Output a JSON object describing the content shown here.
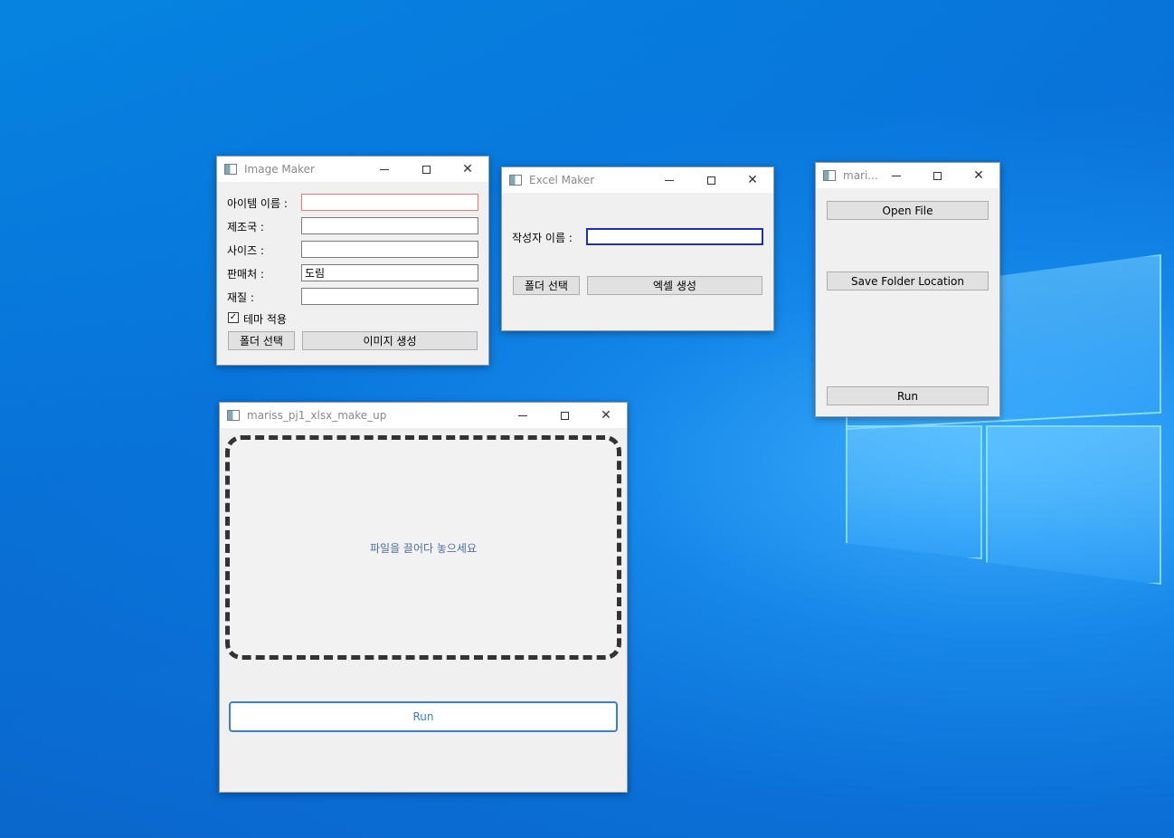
{
  "image_maker": {
    "title": "Image Maker",
    "fields": [
      {
        "label": "아이템 이름 :",
        "value": ""
      },
      {
        "label": "제조국 :",
        "value": ""
      },
      {
        "label": "사이즈 :",
        "value": ""
      },
      {
        "label": "판매처 :",
        "value": "도림"
      },
      {
        "label": "재질 :",
        "value": ""
      }
    ],
    "theme_checkbox_label": "테마 적용",
    "theme_checked": true,
    "folder_button": "폴더 선택",
    "generate_button": "이미지 생성"
  },
  "excel_maker": {
    "title": "Excel Maker",
    "author_label": "작성자 이름 :",
    "author_value": "",
    "folder_button": "폴더 선택",
    "generate_button": "엑셀 생성"
  },
  "small_window": {
    "title": "mari...",
    "open_button": "Open File",
    "save_button": "Save Folder Location",
    "run_button": "Run"
  },
  "main_window": {
    "title": "mariss_pj1_xlsx_make_up",
    "drop_text": "파일을 끌어다 놓으세요",
    "run_button": "Run",
    "accent": "#3b7ddd"
  }
}
